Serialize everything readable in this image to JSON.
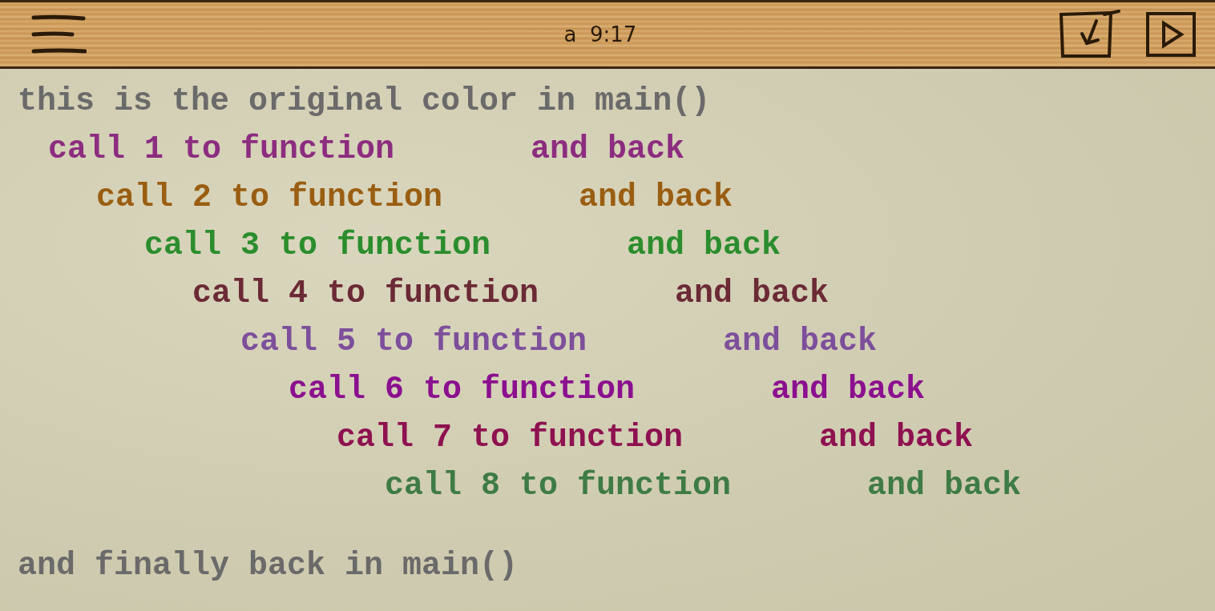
{
  "toolbar": {
    "title": "a  9:17"
  },
  "intro": "this is the original color in main()",
  "calls": [
    {
      "label": "call 1 to function",
      "back": "and back",
      "color": "#8c2d7f",
      "children": [
        {
          "label": "call 2 to function",
          "back": "and back",
          "color": "#9a5e12",
          "children": [
            {
              "label": "call 3 to function",
              "back": "and back",
              "color": "#2b8d2d",
              "children": [
                {
                  "label": "call 4 to function",
                  "back": "and back",
                  "color": "#6b2a35",
                  "children": [
                    {
                      "label": "call 5 to function",
                      "back": "and back",
                      "color": "#7d4f9b",
                      "children": [
                        {
                          "label": "call 6 to function",
                          "back": "and back",
                          "color": "#8b108f",
                          "children": [
                            {
                              "label": "call 7 to function",
                              "back": "and back",
                              "color": "#8e1150",
                              "children": [
                                {
                                  "label": "call 8 to function",
                                  "back": "and back",
                                  "color": "#3f7b45"
                                }
                              ]
                            }
                          ]
                        }
                      ]
                    }
                  ]
                }
              ]
            }
          ]
        }
      ]
    }
  ],
  "outro": "and finally back in main()"
}
